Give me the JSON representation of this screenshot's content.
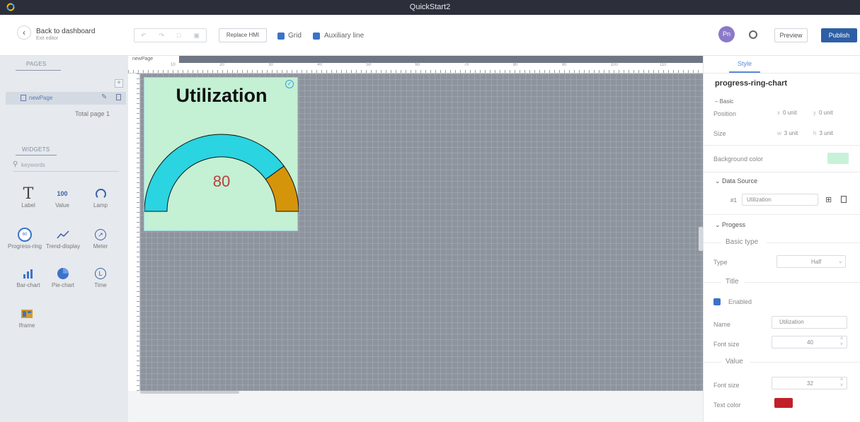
{
  "window": {
    "title": "QuickStart2"
  },
  "toolbar": {
    "back_title": "Back to dashboard",
    "back_subtitle": "Exit editor",
    "replace_label": "Replace HMI",
    "grid_label": "Grid",
    "aux_label": "Auxiliary line",
    "avatar_initials": "Pn",
    "preview_label": "Preview",
    "publish_label": "Publish"
  },
  "pages": {
    "section_title": "PAGES",
    "items": [
      {
        "name": "newPage"
      }
    ],
    "total_label": "Total page 1"
  },
  "widgets": {
    "section_title": "WIDGETS",
    "search_placeholder": "keywords",
    "items": [
      {
        "label": "Label",
        "icon": "text-T-icon"
      },
      {
        "label": "Value",
        "icon": "value-100-icon",
        "glyph": "100"
      },
      {
        "label": "Lamp",
        "icon": "lamp-ring-icon"
      },
      {
        "label": "Progress-ring",
        "icon": "progress-ring-icon",
        "glyph": "60"
      },
      {
        "label": "Trend-display",
        "icon": "trend-line-icon"
      },
      {
        "label": "Meter",
        "icon": "meter-gauge-icon"
      },
      {
        "label": "Bar-chart",
        "icon": "bar-chart-icon"
      },
      {
        "label": "Pie-chart",
        "icon": "pie-chart-icon"
      },
      {
        "label": "Time",
        "icon": "clock-icon"
      },
      {
        "label": "Iframe",
        "icon": "iframe-icon"
      }
    ]
  },
  "canvas": {
    "tab_label": "newPage",
    "ruler_ticks": [
      "10",
      "20",
      "30",
      "40",
      "50",
      "60",
      "70",
      "80",
      "90",
      "100",
      "110"
    ],
    "widget": {
      "title": "Utilization",
      "value": "80",
      "value_fraction": 0.8,
      "colors": {
        "background": "#c4f0d4",
        "progress": "#2ad4e0",
        "remainder": "#d4950a",
        "value_text": "#b84040"
      }
    }
  },
  "style_panel": {
    "tab": "Style",
    "component": "progress-ring-chart",
    "basic": {
      "title": "Basic",
      "position_label": "Position",
      "pos_x_prefix": "x",
      "pos_x": "0 unit",
      "pos_y_prefix": "y",
      "pos_y": "0 unit",
      "size_label": "Size",
      "width_prefix": "w",
      "width": "3 unit",
      "height_prefix": "h",
      "height": "3 unit"
    },
    "background_label": "Background color",
    "background_color": "#c8f2d8",
    "data_source": {
      "title": "Data Source",
      "index": "#1",
      "value": "Utilization"
    },
    "progress": {
      "title": "Progess",
      "basic_type_heading": "Basic type",
      "type_label": "Type",
      "type_value": "Half",
      "title_heading": "Title",
      "enabled_label": "Enabled",
      "name_label": "Name",
      "name_value": "Utilization",
      "font_size_label": "Font size",
      "font_size_value": "40",
      "value_heading": "Value",
      "value_font_size_label": "Font size",
      "value_font_size": "32",
      "text_color_label": "Text color",
      "text_color": "#c0202a"
    }
  }
}
